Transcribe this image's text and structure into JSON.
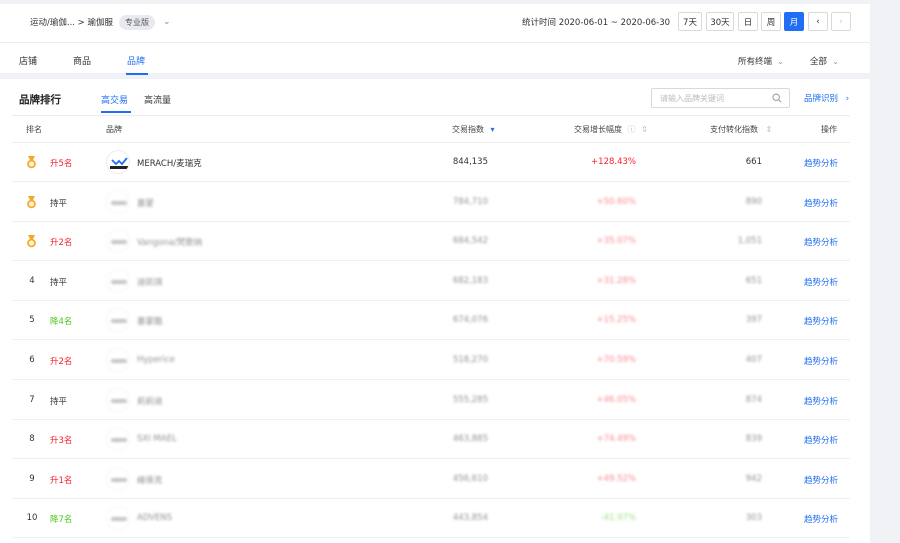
{
  "breadcrumb": {
    "category": "运动/瑜伽... > 瑜伽服",
    "badge": "专业版"
  },
  "stat_time": "统计时间 2020-06-01 ~ 2020-06-30",
  "date_buttons": [
    "7天",
    "30天",
    "日",
    "周",
    "月"
  ],
  "date_active": "月",
  "nav_tabs": [
    "店铺",
    "商品",
    "品牌"
  ],
  "nav_active": "品牌",
  "dropdowns": {
    "terminal": "所有终端",
    "scope": "全部"
  },
  "section": {
    "title": "品牌排行",
    "subtabs": [
      "高交易",
      "高流量"
    ],
    "search_placeholder": "请输入品牌关键词",
    "brand_id_link": "品牌识别"
  },
  "table": {
    "headers": [
      "排名",
      "品牌",
      "交易指数",
      "交易增长幅度",
      "支付转化指数",
      "操作"
    ],
    "action_label": "趋势分析",
    "colors": {
      "up": "#f5222d",
      "down": "#52c41a",
      "flat": "#333333",
      "medal": "#f5a623",
      "accent": "#1f6ef3"
    },
    "rows": [
      {
        "rank": "",
        "medal": true,
        "change": "升5名",
        "dir": "up",
        "brand": "MERACH/麦瑞克",
        "trade_index": "844,135",
        "growth": "+128.43%",
        "conv_index": "661",
        "blur": false
      },
      {
        "rank": "",
        "medal": true,
        "change": "持平",
        "dir": "flat",
        "brand": "暴蒙",
        "trade_index": "784,710",
        "growth": "+50.60%",
        "conv_index": "890",
        "blur": true
      },
      {
        "rank": "",
        "medal": true,
        "change": "升2名",
        "dir": "up",
        "brand": "Vangona/梵歌纳",
        "trade_index": "684,542",
        "growth": "+35.07%",
        "conv_index": "1,051",
        "blur": true
      },
      {
        "rank": "4",
        "medal": false,
        "change": "持平",
        "dir": "flat",
        "brand": "迪凯琪",
        "trade_index": "682,183",
        "growth": "+31.28%",
        "conv_index": "651",
        "blur": true
      },
      {
        "rank": "5",
        "medal": false,
        "change": "降4名",
        "dir": "down",
        "brand": "暴蒙酷",
        "trade_index": "674,076",
        "growth": "+15.25%",
        "conv_index": "397",
        "blur": true
      },
      {
        "rank": "6",
        "medal": false,
        "change": "升2名",
        "dir": "up",
        "brand": "Hyperice",
        "trade_index": "518,270",
        "growth": "+70.59%",
        "conv_index": "407",
        "blur": true
      },
      {
        "rank": "7",
        "medal": false,
        "change": "持平",
        "dir": "flat",
        "brand": "莉莉迪",
        "trade_index": "555,285",
        "growth": "+46.05%",
        "conv_index": "874",
        "blur": true
      },
      {
        "rank": "8",
        "medal": false,
        "change": "升3名",
        "dir": "up",
        "brand": "SXI MAEL",
        "trade_index": "463,885",
        "growth": "+74.49%",
        "conv_index": "839",
        "blur": true
      },
      {
        "rank": "9",
        "medal": false,
        "change": "升1名",
        "dir": "up",
        "brand": "峰徕克",
        "trade_index": "456,610",
        "growth": "+49.52%",
        "conv_index": "942",
        "blur": true
      },
      {
        "rank": "10",
        "medal": false,
        "change": "降7名",
        "dir": "down",
        "brand": "ADVENS",
        "trade_index": "443,854",
        "growth": "-41.97%",
        "conv_index": "303",
        "blur": true
      }
    ]
  }
}
